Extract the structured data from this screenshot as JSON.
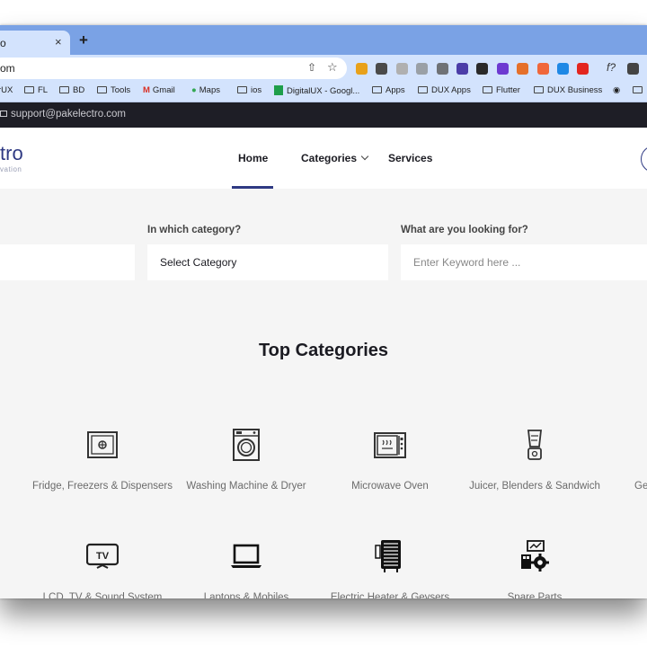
{
  "browser": {
    "tab_title": "o",
    "tab_close": "×",
    "new_tab": "+",
    "address": "om",
    "share_glyph": "⇧",
    "star_glyph": "☆",
    "ext_glyph_f": "f?",
    "extensions": [
      {
        "name": "ext-orange",
        "color": "#e8a11a"
      },
      {
        "name": "ext-dark",
        "color": "#4a4a4a"
      },
      {
        "name": "ext-grid",
        "color": "#b0b0b0"
      },
      {
        "name": "ext-circle",
        "color": "#9aa0a6"
      },
      {
        "name": "ext-camera",
        "color": "#6f7276"
      },
      {
        "name": "ext-stack",
        "color": "#4b3da8"
      },
      {
        "name": "ext-chat",
        "color": "#2a2a2a"
      },
      {
        "name": "ext-flower",
        "color": "#6d3ad1"
      },
      {
        "name": "ext-moon",
        "color": "#e5702a"
      },
      {
        "name": "ext-g",
        "color": "#f0673a"
      },
      {
        "name": "ext-download",
        "color": "#1e88e5"
      },
      {
        "name": "ext-opera",
        "color": "#e3261f"
      },
      {
        "name": "ext-video",
        "color": "#444444"
      }
    ]
  },
  "bookmarks": [
    {
      "label": "rUX",
      "folder": false
    },
    {
      "label": "FL",
      "folder": true
    },
    {
      "label": "BD",
      "folder": true
    },
    {
      "label": "Tools",
      "folder": true
    },
    {
      "label": "Gmail",
      "folder": false
    },
    {
      "label": "Maps",
      "folder": false
    },
    {
      "label": "ios",
      "folder": true
    },
    {
      "label": "DigitalUX - Googl...",
      "folder": false
    },
    {
      "label": "Apps",
      "folder": true
    },
    {
      "label": "DUX Apps",
      "folder": true
    },
    {
      "label": "Flutter",
      "folder": true
    },
    {
      "label": "DUX Business",
      "folder": true
    }
  ],
  "site": {
    "support_email": "support@pakelectro.com",
    "logo_text": "tro",
    "logo_tagline": "vation",
    "nav": {
      "home": "Home",
      "categories": "Categories",
      "services": "Services"
    },
    "search": {
      "category_label": "In which category?",
      "category_value": "Select Category",
      "keyword_label": "What are you looking for?",
      "keyword_placeholder": "Enter Keyword here ..."
    },
    "section_title": "Top Categories",
    "categories": [
      {
        "label": "Fridge, Freezers & Dispensers",
        "icon": "fridge-icon"
      },
      {
        "label": "Washing Machine & Dryer",
        "icon": "washing-machine-icon"
      },
      {
        "label": "Microwave Oven",
        "icon": "microwave-icon"
      },
      {
        "label": "Juicer, Blenders & Sandwich",
        "icon": "blender-icon"
      },
      {
        "label": "Ge",
        "icon": "generator-icon"
      },
      {
        "label": "LCD, TV & Sound System",
        "icon": "tv-icon",
        "icon_text": "TV"
      },
      {
        "label": "Laptops & Mobiles",
        "icon": "laptop-icon"
      },
      {
        "label": "Electric Heater & Geysers",
        "icon": "heater-icon"
      },
      {
        "label": "Spare Parts",
        "icon": "spare-parts-icon"
      }
    ]
  }
}
